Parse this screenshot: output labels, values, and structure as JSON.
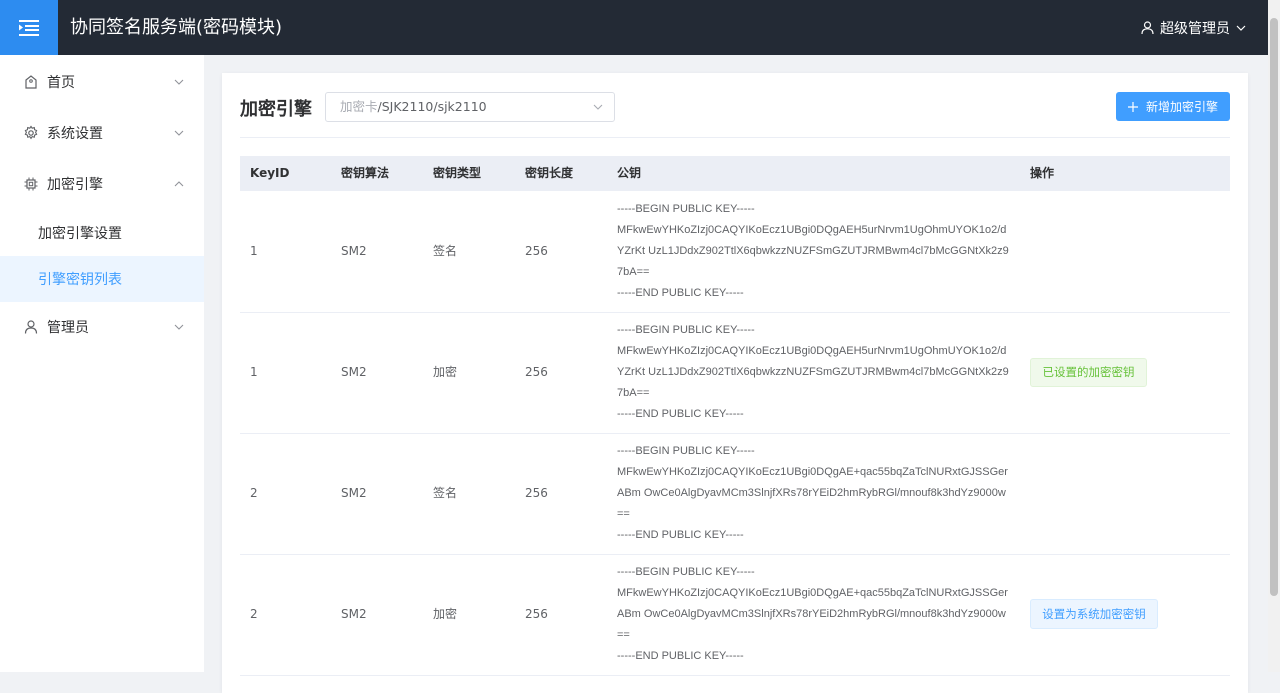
{
  "header": {
    "title": "协同签名服务端(密码模块)",
    "user": "超级管理员"
  },
  "sidebar": {
    "items": [
      {
        "label": "首页",
        "icon": "home-icon"
      },
      {
        "label": "系统设置",
        "icon": "gear-icon"
      },
      {
        "label": "加密引擎",
        "icon": "chip-icon",
        "expanded": true,
        "children": [
          {
            "label": "加密引擎设置"
          },
          {
            "label": "引擎密钥列表",
            "active": true
          }
        ]
      },
      {
        "label": "管理员",
        "icon": "user-icon"
      }
    ]
  },
  "main": {
    "title": "加密引擎",
    "engine_select": {
      "prefix": "加密卡",
      "value": "/SJK2110/sjk2110"
    },
    "add_button": "新增加密引擎",
    "table": {
      "columns": [
        "KeyID",
        "密钥算法",
        "密钥类型",
        "密钥长度",
        "公钥",
        "操作"
      ],
      "rows": [
        {
          "keyid": "1",
          "algo": "SM2",
          "type": "签名",
          "length": "256",
          "pubkey": [
            "-----BEGIN PUBLIC KEY-----",
            "MFkwEwYHKoZIzj0CAQYIKoEcz1UBgi0DQgAEH5urNrvm1UgOhmUYOK1o2/d",
            "YZrKt UzL1JDdxZ902TtlX6qbwkzzNUZFSmGZUTJRMBwm4cl7bMcGGNtXk2z9",
            "7bA==",
            "-----END PUBLIC KEY-----"
          ],
          "op": ""
        },
        {
          "keyid": "1",
          "algo": "SM2",
          "type": "加密",
          "length": "256",
          "pubkey": [
            "-----BEGIN PUBLIC KEY-----",
            "MFkwEwYHKoZIzj0CAQYIKoEcz1UBgi0DQgAEH5urNrvm1UgOhmUYOK1o2/d",
            "YZrKt UzL1JDdxZ902TtlX6qbwkzzNUZFSmGZUTJRMBwm4cl7bMcGGNtXk2z9",
            "7bA==",
            "-----END PUBLIC KEY-----"
          ],
          "op": "已设置的加密密钥"
        },
        {
          "keyid": "2",
          "algo": "SM2",
          "type": "签名",
          "length": "256",
          "pubkey": [
            "-----BEGIN PUBLIC KEY-----",
            "MFkwEwYHKoZIzj0CAQYIKoEcz1UBgi0DQgAE+qac55bqZaTclNURxtGJSSGer",
            "ABm OwCe0AlgDyavMCm3SlnjfXRs78rYEiD2hmRybRGl/mnouf8k3hdYz9000w",
            "==",
            "-----END PUBLIC KEY-----"
          ],
          "op": ""
        },
        {
          "keyid": "2",
          "algo": "SM2",
          "type": "加密",
          "length": "256",
          "pubkey": [
            "-----BEGIN PUBLIC KEY-----",
            "MFkwEwYHKoZIzj0CAQYIKoEcz1UBgi0DQgAE+qac55bqZaTclNURxtGJSSGer",
            "ABm OwCe0AlgDyavMCm3SlnjfXRs78rYEiD2hmRybRGl/mnouf8k3hdYz9000w",
            "==",
            "-----END PUBLIC KEY-----"
          ],
          "op": "设置为系统加密密钥"
        }
      ]
    }
  },
  "colors": {
    "header_bg": "#232a35",
    "accent": "#409eff",
    "toggle_bg": "#2d8cf0",
    "success": "#67c23a"
  }
}
